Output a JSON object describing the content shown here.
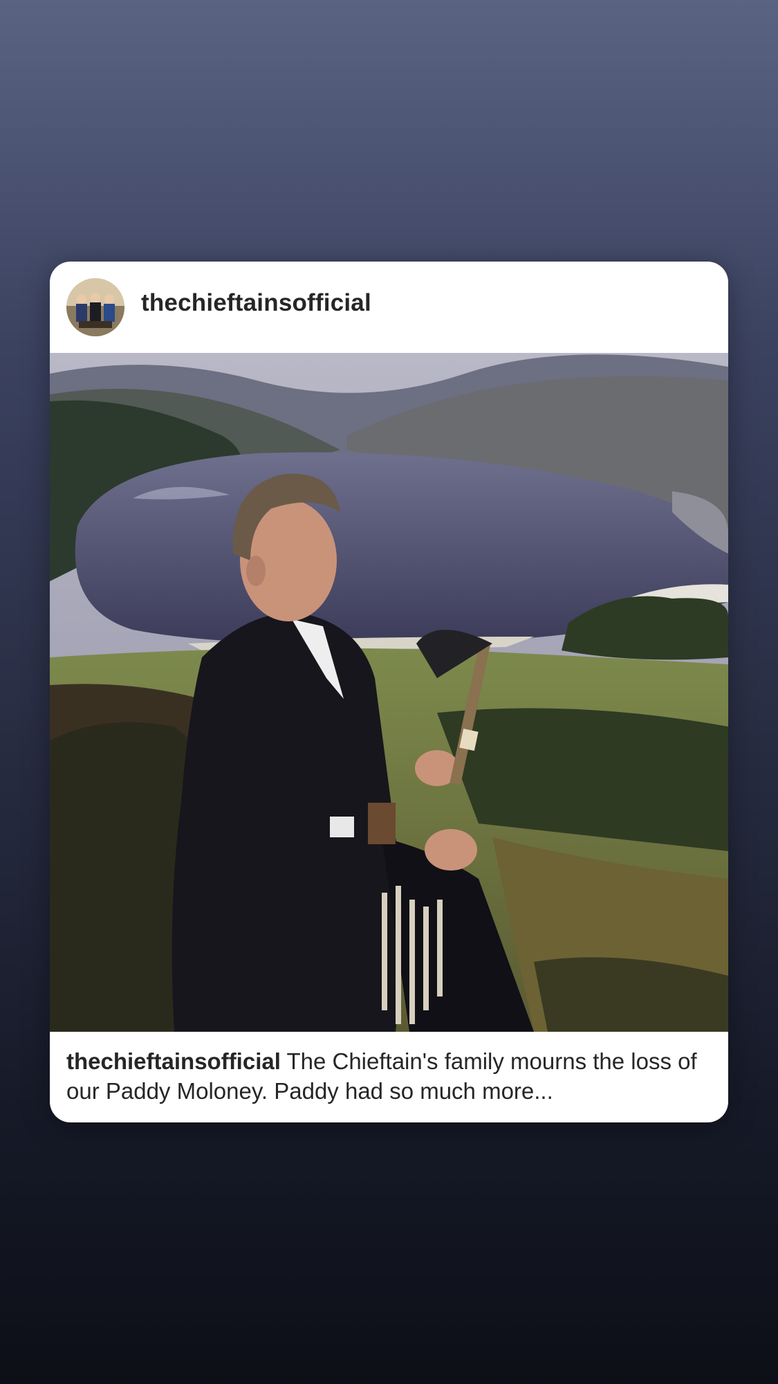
{
  "post": {
    "username": "thechieftainsofficial",
    "caption_user": "thechieftainsofficial",
    "caption_text": "The Chieftain's family mourns the loss of our Paddy Moloney. Paddy had so much more..."
  },
  "colors": {
    "background_top": "#5a6382",
    "background_bottom": "#0d0f17",
    "card": "#ffffff",
    "text": "#262626"
  }
}
